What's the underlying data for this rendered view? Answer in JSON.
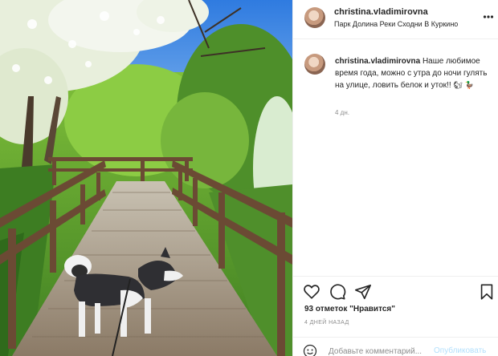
{
  "post": {
    "photo": {
      "alt": "",
      "subject": "husky on a wooden boardwalk between blossoming trees"
    },
    "header": {
      "username": "christina.vladimirovna",
      "location": "Парк Долина Реки Сходни В Куркино",
      "more_icon": "more-dots-icon"
    },
    "caption": {
      "username": "christina.vladimirovna",
      "text": "Наше любимое время года, можно с утра до ночи гулять на улице, ловить белок и уток!! ",
      "emojis": [
        "🐿",
        "🦆"
      ],
      "time": "4 дн."
    },
    "actions": {
      "icons": [
        "heart-icon",
        "comment-icon",
        "share-icon",
        "bookmark-icon"
      ]
    },
    "likes": "93 отметок \"Нравится\"",
    "posted_ago": "4 ДНЕЙ НАЗАД",
    "comment": {
      "placeholder": "Добавьте комментарий...",
      "publish_label": "Опубликовать"
    },
    "colors": {
      "link_disabled": "#b2dffc",
      "text": "#262626",
      "muted": "#8e8e8e",
      "divider": "#efefef"
    }
  }
}
